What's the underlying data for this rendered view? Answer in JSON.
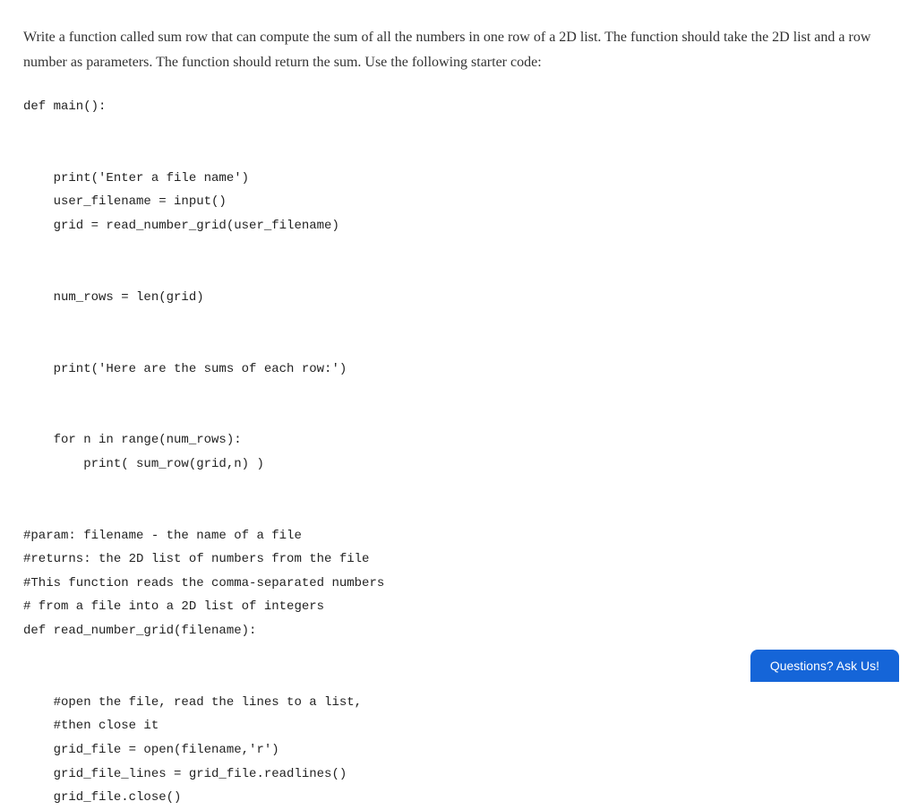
{
  "problem": {
    "description": "Write a function called sum row that can compute the sum of all the numbers in one row of a 2D list. The function should take the 2D list and a row number as parameters. The function should return the sum. Use the following starter code:"
  },
  "code": {
    "lines": [
      "def main():",
      "",
      "",
      "    print('Enter a file name')",
      "    user_filename = input()",
      "    grid = read_number_grid(user_filename)",
      "",
      "",
      "    num_rows = len(grid)",
      "",
      "",
      "    print('Here are the sums of each row:')",
      "",
      "",
      "    for n in range(num_rows):",
      "        print( sum_row(grid,n) )",
      "",
      "",
      "#param: filename - the name of a file",
      "#returns: the 2D list of numbers from the file",
      "#This function reads the comma-separated numbers",
      "# from a file into a 2D list of integers",
      "def read_number_grid(filename):",
      "",
      "",
      "    #open the file, read the lines to a list,",
      "    #then close it",
      "    grid_file = open(filename,'r')",
      "    grid_file_lines = grid_file.readlines()",
      "    grid_file.close()"
    ]
  },
  "footer": {
    "ask_label": "Questions? Ask Us!"
  }
}
